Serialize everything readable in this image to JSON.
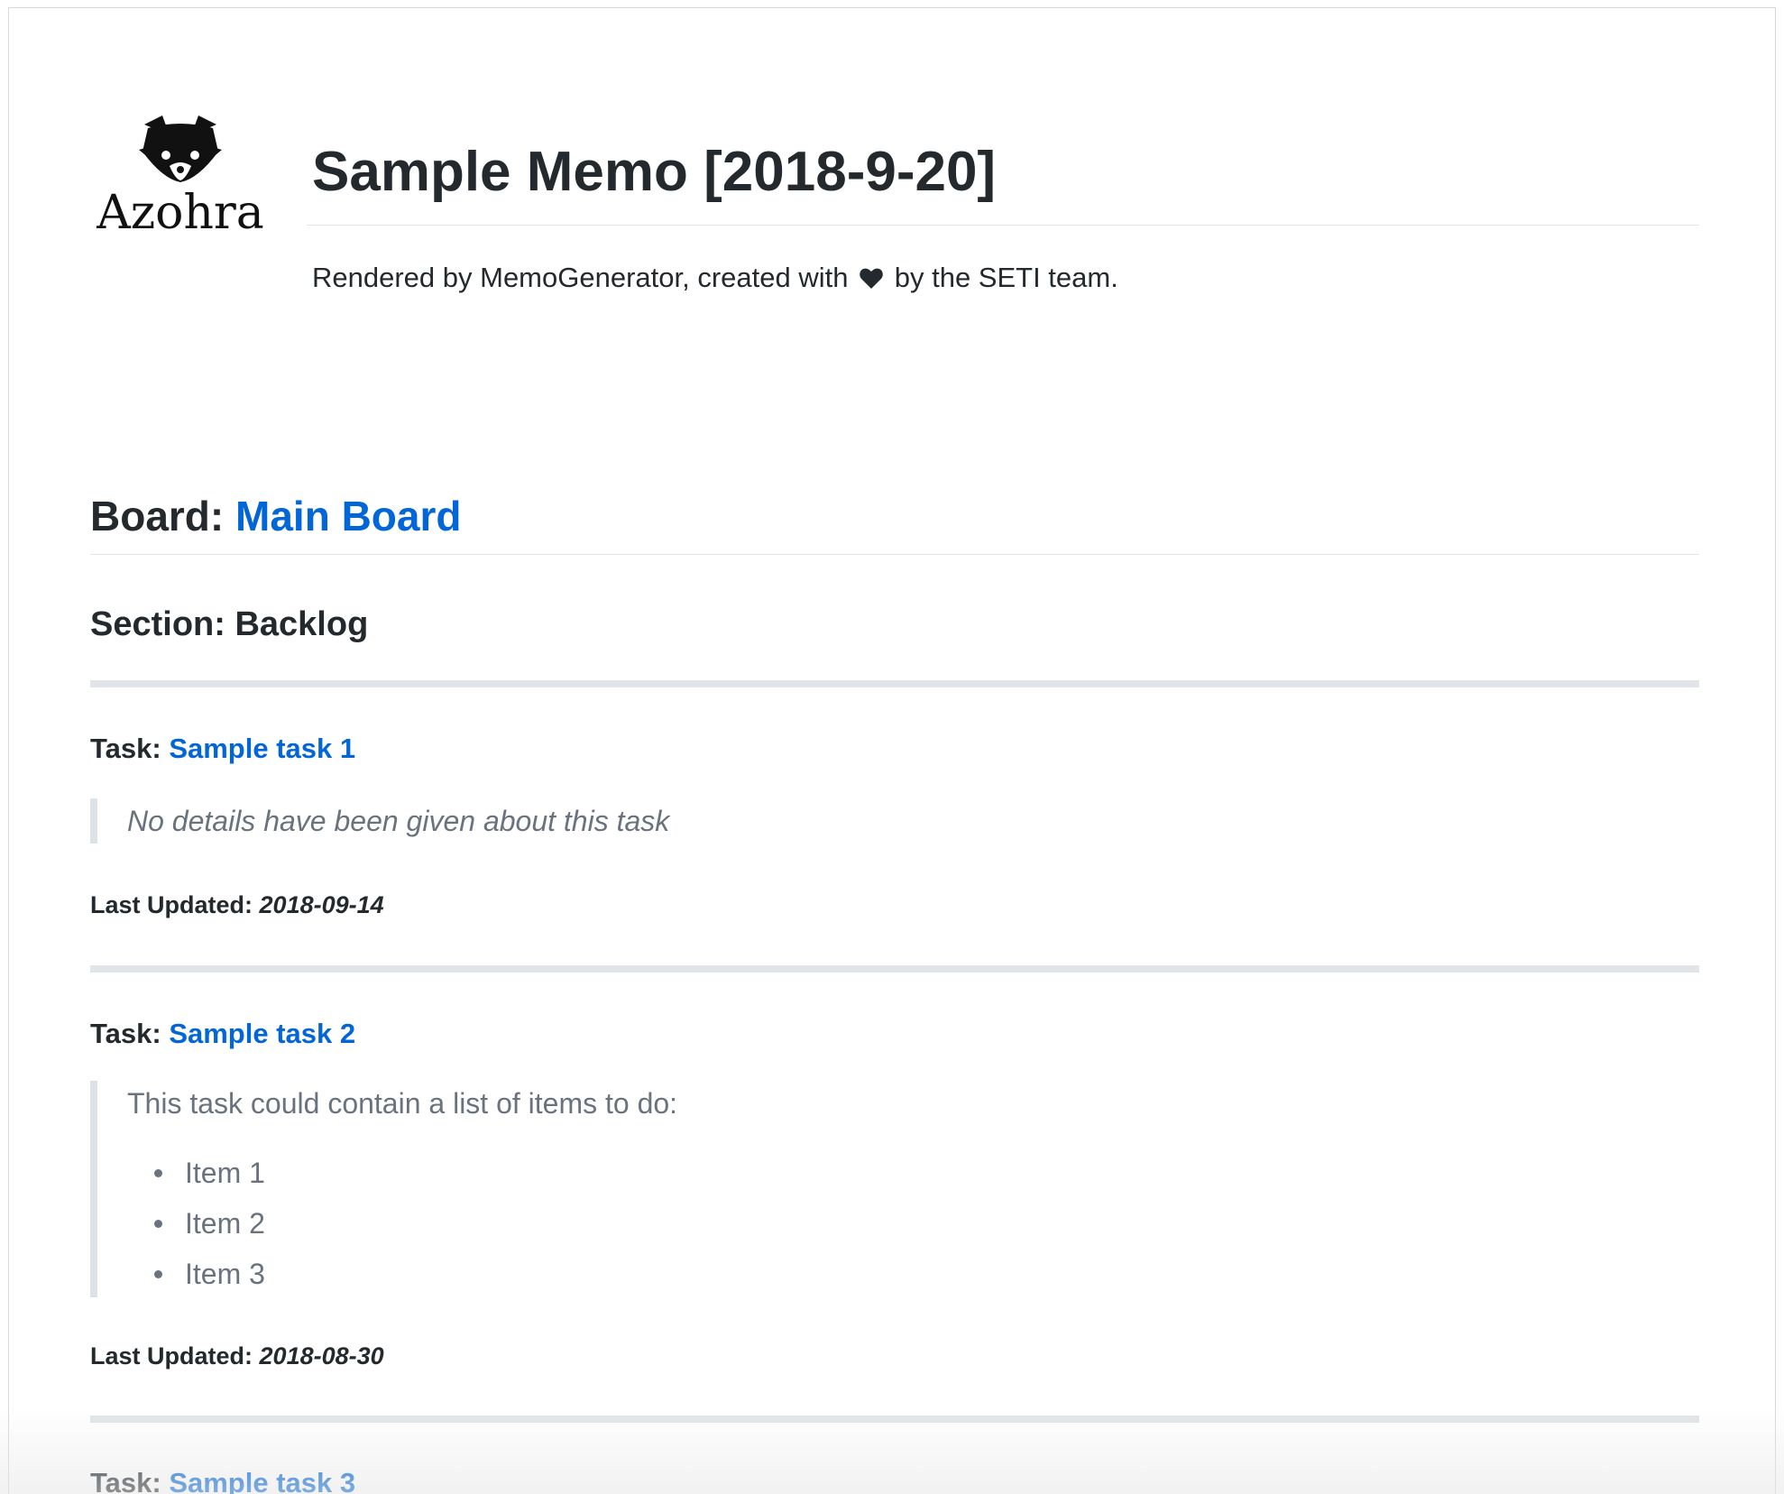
{
  "header": {
    "logo_text": "Azohra",
    "title": "Sample Memo [2018-9-20]",
    "subtitle_before": "Rendered by MemoGenerator, created with",
    "subtitle_after": "by the SETI team."
  },
  "board": {
    "prefix": "Board:",
    "name": "Main Board"
  },
  "section": {
    "heading": "Section: Backlog"
  },
  "tasks": [
    {
      "prefix": "Task:",
      "name": "Sample task 1",
      "details": "No details have been given about this task",
      "updated_label": "Last Updated:",
      "updated_date": "2018-09-14"
    },
    {
      "prefix": "Task:",
      "name": "Sample task 2",
      "details": "This task could contain a list of items to do:",
      "items": [
        "Item 1",
        "Item 2",
        "Item 3"
      ],
      "updated_label": "Last Updated:",
      "updated_date": "2018-08-30"
    },
    {
      "prefix": "Task:",
      "name": "Sample task 3"
    }
  ],
  "colors": {
    "link": "#0366d6",
    "text": "#24292e",
    "muted": "#6a737d",
    "rule": "#e1e4e8"
  },
  "icons": {
    "logo": "raccoon-icon",
    "heart": "heart-icon"
  }
}
